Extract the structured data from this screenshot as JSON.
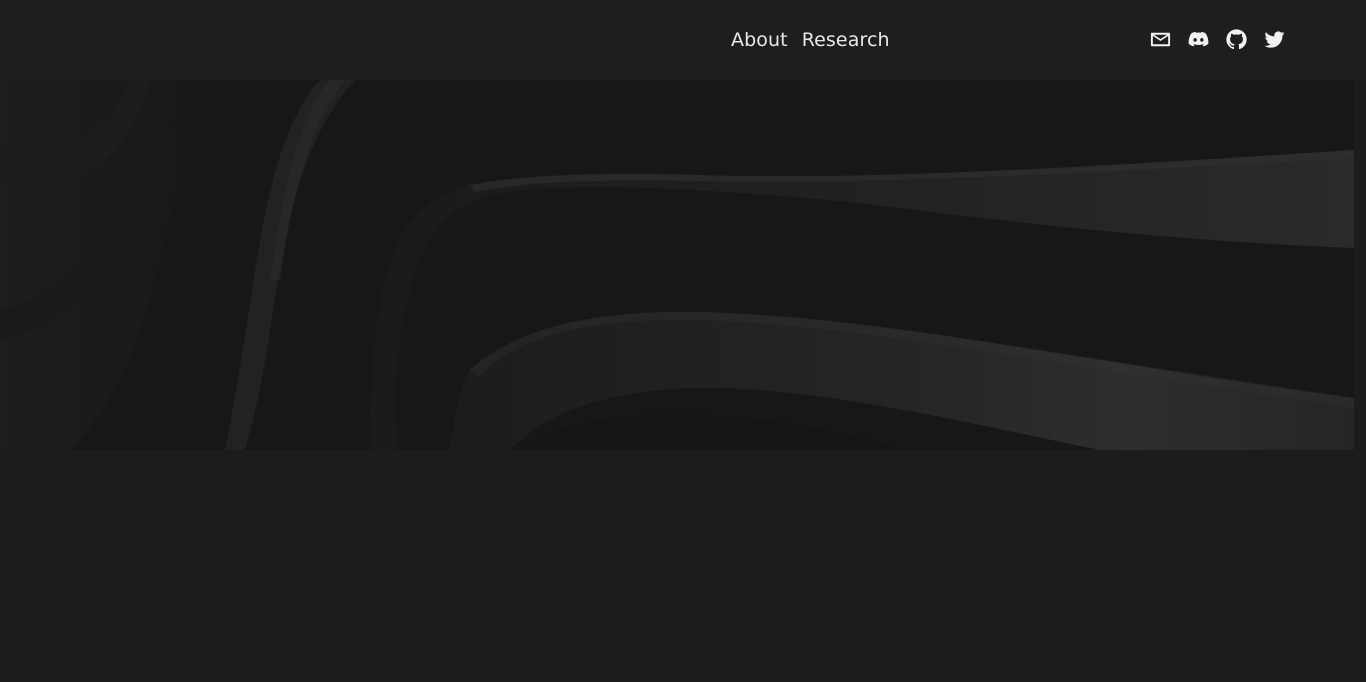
{
  "nav": {
    "links": [
      {
        "label": "About"
      },
      {
        "label": "Research"
      }
    ]
  },
  "social": {
    "icons": [
      "mail-icon",
      "discord-icon",
      "github-icon",
      "twitter-icon"
    ]
  },
  "theme": {
    "background": "#1c1c1c",
    "header_bg": "#1e1e1e",
    "text": "#e9e9e9"
  }
}
